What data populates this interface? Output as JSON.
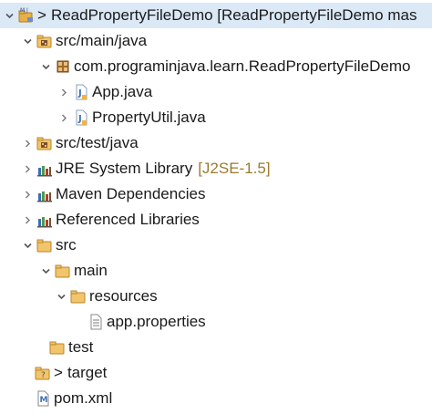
{
  "tree": {
    "project": {
      "prefix": ">",
      "label": "ReadPropertyFileDemo [ReadPropertyFileDemo mas"
    },
    "src_main_java": "src/main/java",
    "package": "com.programinjava.learn.ReadPropertyFileDemo",
    "app_java": "App.java",
    "property_util": "PropertyUtil.java",
    "src_test_java": "src/test/java",
    "jre": {
      "label": "JRE System Library",
      "decoration": "[J2SE-1.5]"
    },
    "maven_deps": "Maven Dependencies",
    "ref_libs": "Referenced Libraries",
    "src": "src",
    "main": "main",
    "resources": "resources",
    "app_properties": "app.properties",
    "test": "test",
    "target": {
      "prefix": ">",
      "label": "target"
    },
    "pom": "pom.xml"
  },
  "colors": {
    "selection": "#dbe8f6",
    "decoration": "#9b7b2f",
    "folder": "#e8b04a",
    "java_accent": "#3b6fb6"
  },
  "icons": {
    "project": "maven-project-icon",
    "source_folder": "source-folder-icon",
    "package": "package-icon",
    "java_file": "java-file-icon",
    "library": "library-icon",
    "folder": "folder-icon",
    "file": "properties-file-icon",
    "xml": "xml-file-icon"
  }
}
